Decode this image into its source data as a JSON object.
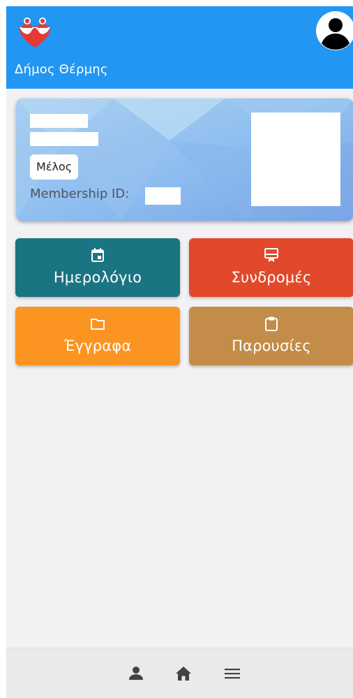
{
  "header": {
    "title": "Δήμος Θέρμης",
    "logo_icon": "people-heart-logo",
    "account_icon": "account-circle-icon",
    "color": "#2196f3"
  },
  "card": {
    "badge": "Μέλος",
    "membership_label": "Membership ID:"
  },
  "tiles": [
    {
      "label": "Ημερολόγιο",
      "icon": "calendar-icon",
      "color": "#1a7482"
    },
    {
      "label": "Συνδρομές",
      "icon": "subscription-card-icon",
      "color": "#e2482a"
    },
    {
      "label": "Έγγραφα",
      "icon": "folder-icon",
      "color": "#fb9420"
    },
    {
      "label": "Παρουσίες",
      "icon": "clipboard-icon",
      "color": "#c38c48"
    }
  ],
  "bottom_nav": {
    "items": [
      "person-icon",
      "home-icon",
      "menu-icon"
    ]
  }
}
